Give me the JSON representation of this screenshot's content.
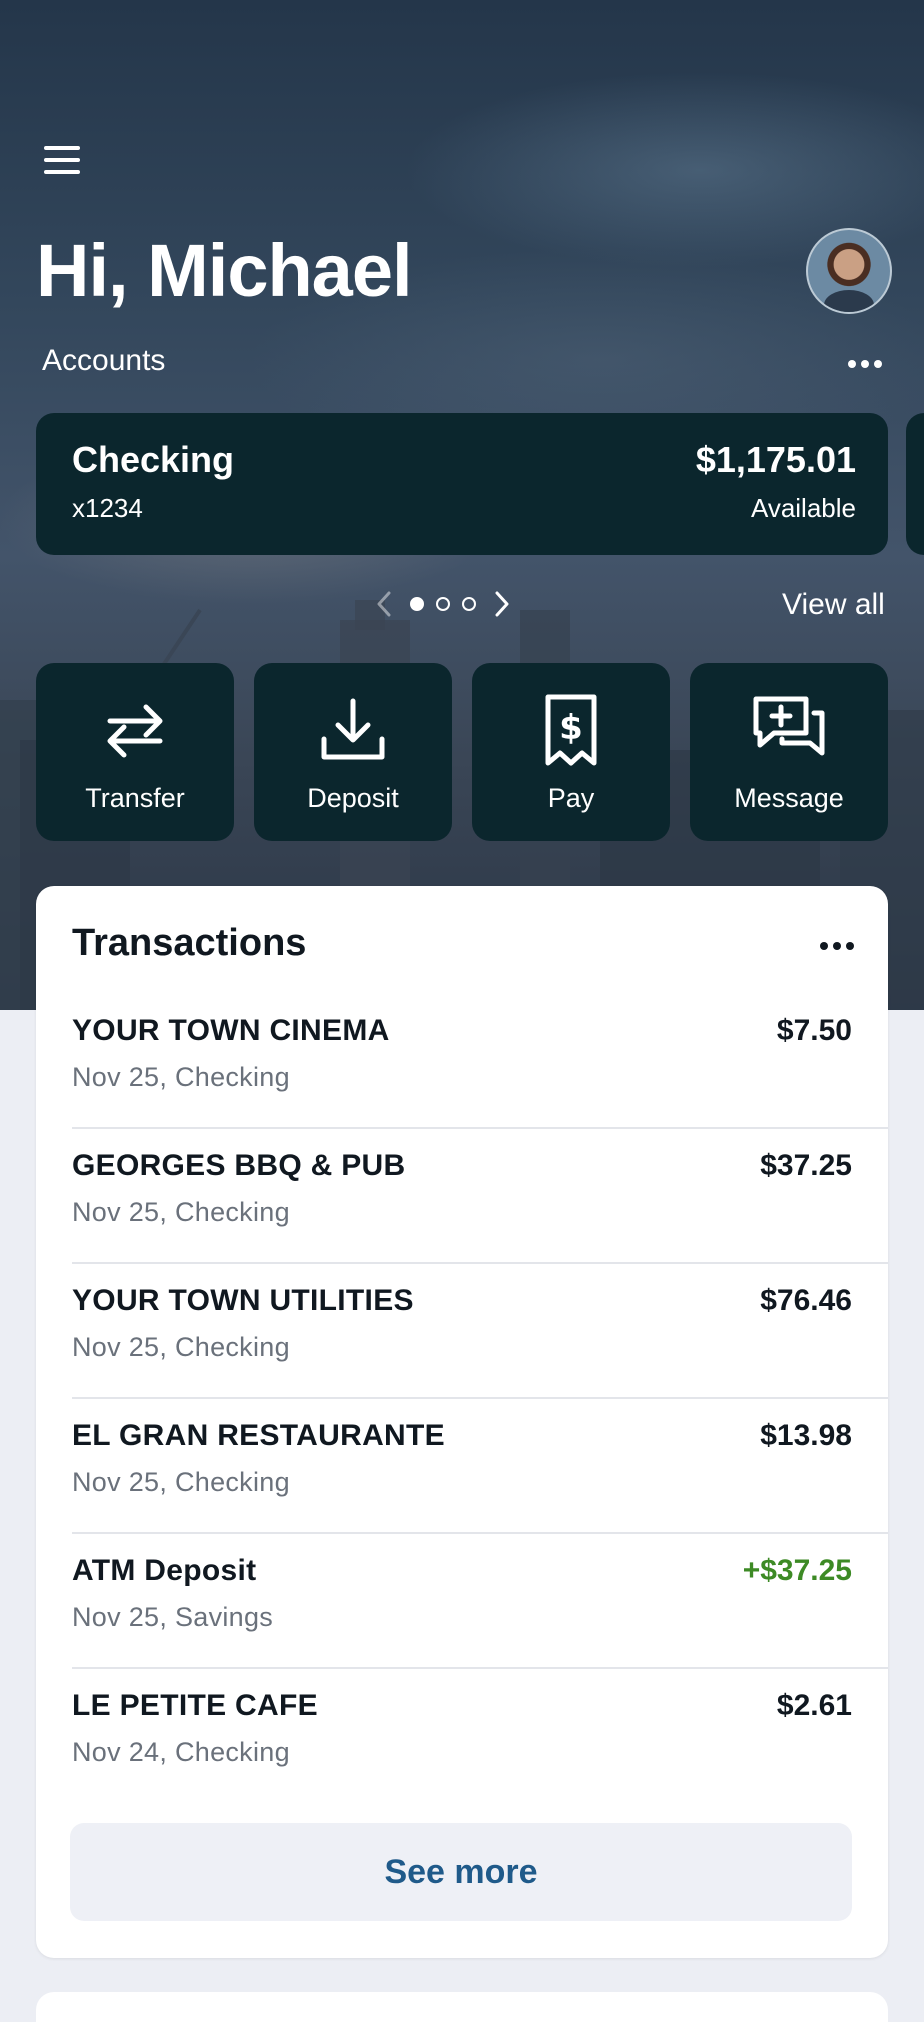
{
  "header": {
    "greeting": "Hi, Michael",
    "accounts_label": "Accounts",
    "view_all": "View all"
  },
  "account": {
    "name": "Checking",
    "number": "x1234",
    "balance": "$1,175.01",
    "balance_label": "Available"
  },
  "pager": {
    "total": 3,
    "current": 1
  },
  "actions": [
    {
      "label": "Transfer",
      "icon": "transfer-icon"
    },
    {
      "label": "Deposit",
      "icon": "deposit-icon"
    },
    {
      "label": "Pay",
      "icon": "bill-pay-icon"
    },
    {
      "label": "Message",
      "icon": "message-icon"
    }
  ],
  "transactions": {
    "title": "Transactions",
    "items": [
      {
        "name": "YOUR TOWN CINEMA",
        "detail": "Nov 25, Checking",
        "amount": "$7.50",
        "credit": false
      },
      {
        "name": "GEORGES BBQ & PUB",
        "detail": "Nov 25, Checking",
        "amount": "$37.25",
        "credit": false
      },
      {
        "name": "YOUR TOWN UTILITIES",
        "detail": "Nov 25, Checking",
        "amount": "$76.46",
        "credit": false
      },
      {
        "name": "EL GRAN RESTAURANTE",
        "detail": "Nov 25, Checking",
        "amount": "$13.98",
        "credit": false
      },
      {
        "name": "ATM Deposit",
        "detail": "Nov 25, Savings",
        "amount": "+$37.25",
        "credit": true
      },
      {
        "name": "LE PETITE CAFE",
        "detail": "Nov 24, Checking",
        "amount": "$2.61",
        "credit": false
      }
    ],
    "see_more": "See more"
  },
  "colors": {
    "card_dark": "#0b262d",
    "credit_green": "#3d8a25",
    "link_blue": "#1f5a8a",
    "page_bg": "#eceef4"
  }
}
